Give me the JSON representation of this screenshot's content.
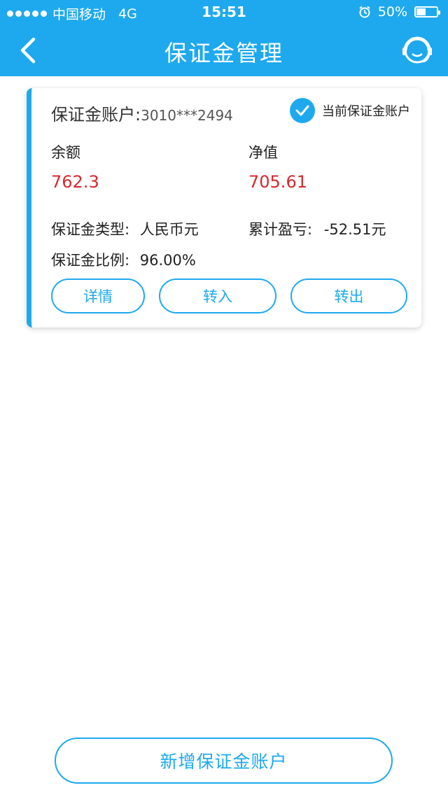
{
  "status_bar": {
    "carrier": "中国移动",
    "network": "4G",
    "time": "15:51",
    "battery_text": "50%",
    "battery_level": 0.5
  },
  "header": {
    "title": "保证金管理",
    "back_icon": "chevron-left-icon",
    "service_icon": "customer-service-icon"
  },
  "account_card": {
    "account_label": "保证金账户:",
    "account_number": "3010***2494",
    "current_label": "当前保证金账户",
    "balance_label": "余额",
    "balance_value": "762.3",
    "net_label": "净值",
    "net_value": "705.61",
    "type_label": "保证金类型:",
    "type_value": "人民币元",
    "pnl_label": "累计盈亏:",
    "pnl_value": "-52.51元",
    "ratio_label": "保证金比例:",
    "ratio_value": "96.00%",
    "buttons": {
      "details": "详情",
      "transfer_in": "转入",
      "transfer_out": "转出"
    }
  },
  "footer": {
    "add_account": "新增保证金账户"
  },
  "colors": {
    "accent": "#1ea9ee",
    "value_red": "#d7282d"
  }
}
